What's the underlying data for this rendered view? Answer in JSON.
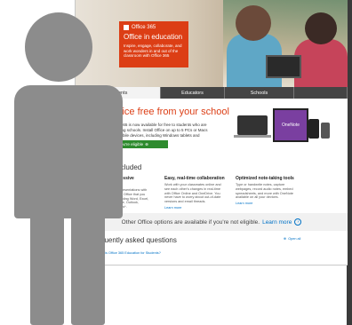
{
  "hero": {
    "brand": "Office 365",
    "title": "Office in education",
    "desc": "Inspire, engage, collaborate, and work wonders in and out of the classroom with Office 365"
  },
  "tabs": [
    "Students",
    "Educators",
    "Schools",
    ""
  ],
  "free": {
    "title": "Office free from your school",
    "desc": "Office 365 is now available for free to students who are attending schools. Install Office on up to 5 PCs or Macs and mobile devices, including Windows tablets and iPads.",
    "button": "See if you're eligible",
    "tablet_label": "OneNote"
  },
  "included": {
    "title": "What's included",
    "columns": [
      {
        "heading": "Familiar, impressive applications",
        "text": "Create impressive presentations with the latest versions of Office that you know and trust, including Word, Excel, PowerPoint, OneNote, Outlook, Publisher, and Access*.",
        "link": ""
      },
      {
        "heading": "Easy, real-time collaboration",
        "text": "Work with your classmates online and see each other's changes in real-time with Office Online and OneDrive. You never have to worry about out-of-date versions and email threads.",
        "link": "Learn more"
      },
      {
        "heading": "Optimized note-taking tools",
        "text": "Type or handwrite notes, capture webpages, record audio notes, embed spreadsheets, and more with OneNote available on all your devices.",
        "link": "Learn more"
      }
    ]
  },
  "other": {
    "text": "Other Office options are available if you're not eligible.",
    "link": "Learn more"
  },
  "faq": {
    "title": "Frequently asked questions",
    "open_all": "Open all",
    "question": "What is Office 365 Education for Students?"
  },
  "colors": {
    "accent": "#dc3e15",
    "link": "#0072c6",
    "button": "#2e8b2e",
    "figure": "#8c8c8c"
  }
}
